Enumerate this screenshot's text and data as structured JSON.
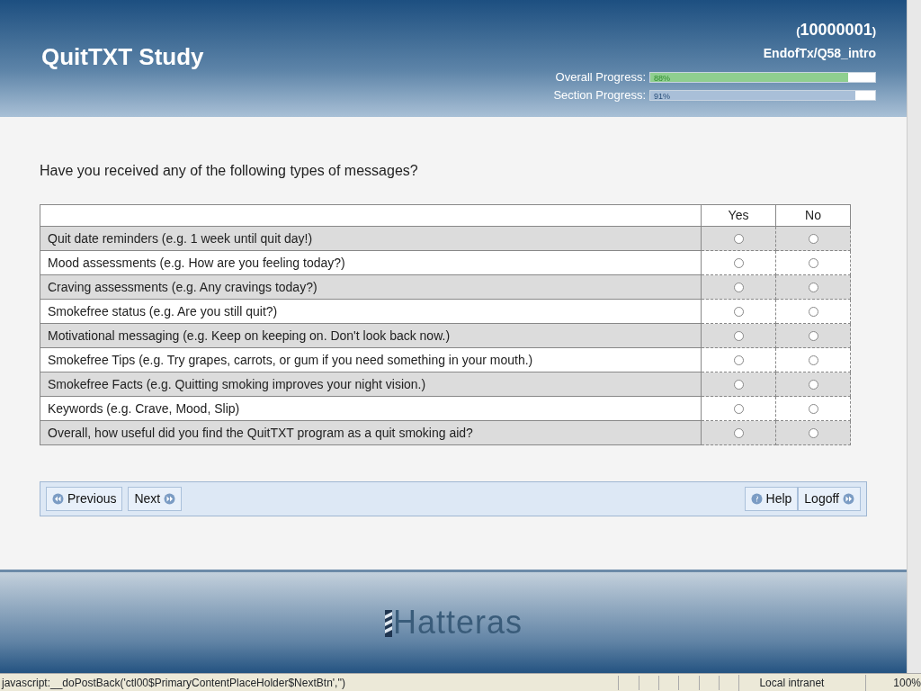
{
  "header": {
    "title": "QuitTXT Study",
    "participant_open": "(",
    "participant_id": "10000001",
    "participant_close": ")",
    "page_code": "EndofTx/Q58_intro",
    "progress": [
      {
        "label": "Overall Progress:",
        "level": 0.88,
        "reading": "88%",
        "color": "#8fcf8f"
      },
      {
        "label": "Section Progress:",
        "level": 0.91,
        "reading": "91%",
        "color": "#a9bfd8"
      }
    ]
  },
  "question": "Have you received any of the following types of messages?",
  "grid": {
    "columns": [
      "Yes",
      "No"
    ],
    "rows": [
      {
        "label": "Quit date reminders (e.g. 1 week until quit day!)",
        "answers": [
          {
            "selected": false
          },
          {
            "selected": false
          }
        ]
      },
      {
        "label": "Mood assessments (e.g. How are you feeling today?)",
        "answers": [
          {
            "selected": false
          },
          {
            "selected": false
          }
        ]
      },
      {
        "label": "Craving assessments (e.g. Any cravings today?)",
        "answers": [
          {
            "selected": false
          },
          {
            "selected": false
          }
        ]
      },
      {
        "label": "Smokefree status (e.g. Are you still quit?)",
        "answers": [
          {
            "selected": false
          },
          {
            "selected": false
          }
        ]
      },
      {
        "label": "Motivational messaging (e.g. Keep on keeping on. Don't look back now.)",
        "answers": [
          {
            "selected": false
          },
          {
            "selected": false
          }
        ]
      },
      {
        "label": "Smokefree Tips (e.g. Try grapes, carrots, or gum if you need something in your mouth.)",
        "answers": [
          {
            "selected": false
          },
          {
            "selected": false
          }
        ]
      },
      {
        "label": "Smokefree Facts (e.g. Quitting smoking improves your night vision.)",
        "answers": [
          {
            "selected": false
          },
          {
            "selected": false
          }
        ]
      },
      {
        "label": "Keywords (e.g. Crave, Mood, Slip)",
        "answers": [
          {
            "selected": false
          },
          {
            "selected": false
          }
        ]
      },
      {
        "label": "Overall, how useful did you find the QuitTXT program as a quit smoking aid?",
        "answers": [
          {
            "selected": false
          },
          {
            "selected": false
          }
        ]
      }
    ]
  },
  "nav_left": [
    {
      "label": "Previous",
      "kind": "back"
    },
    {
      "label": "Next",
      "kind": "forward"
    }
  ],
  "nav_right": [
    {
      "label": "Help",
      "kind": "help"
    },
    {
      "label": "Logoff",
      "kind": "forward"
    }
  ],
  "footer": {
    "logo": "Hatteras"
  },
  "status_bar": {
    "text": "javascript:__doPostBack('ctl00$PrimaryContentPlaceHolder$NextBtn','')",
    "zone": "Local intranet",
    "zoom": "100%"
  }
}
